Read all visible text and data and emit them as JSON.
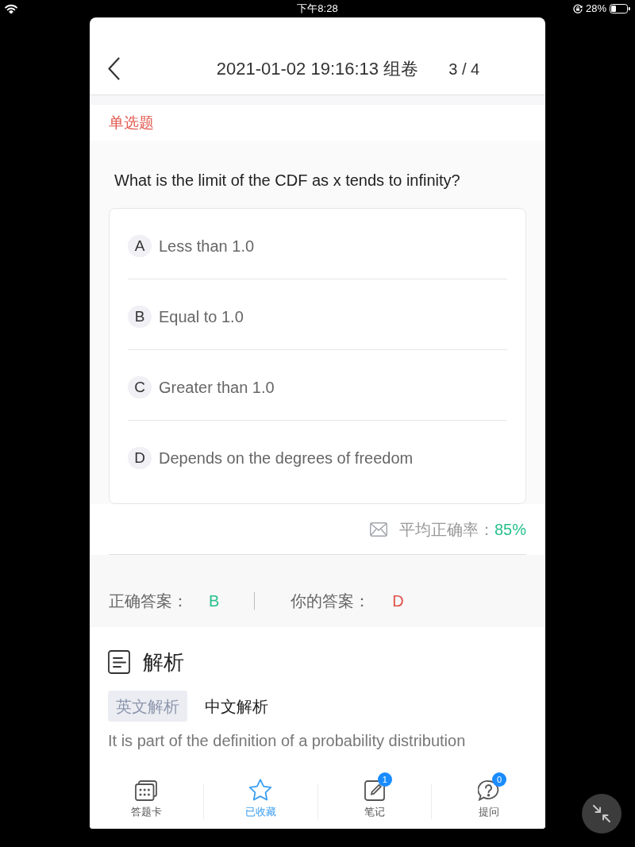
{
  "status_bar": {
    "time": "下午8:28",
    "battery": "28%"
  },
  "header": {
    "title": "2021-01-02 19:16:13 组卷",
    "progress": "3 / 4"
  },
  "question": {
    "type_label": "单选题",
    "text": "What is the limit of the CDF as x tends to infinity?",
    "options": [
      {
        "letter": "A",
        "text": "Less than 1.0"
      },
      {
        "letter": "B",
        "text": "Equal to 1.0"
      },
      {
        "letter": "C",
        "text": "Greater than 1.0"
      },
      {
        "letter": "D",
        "text": "Depends on the degrees of freedom"
      }
    ]
  },
  "stats": {
    "label": "平均正确率：",
    "value": "85%"
  },
  "answers": {
    "correct_label": "正确答案：",
    "correct": "B",
    "yours_label": "你的答案：",
    "yours": "D"
  },
  "analysis": {
    "title": "解析",
    "tabs": [
      {
        "label": "英文解析",
        "selected": true
      },
      {
        "label": "中文解析",
        "selected": false
      }
    ],
    "text": "It is part of the definition of a probability distribution"
  },
  "bottom_nav": [
    {
      "label": "答题卡",
      "selected": false
    },
    {
      "label": "已收藏",
      "selected": true
    },
    {
      "label": "笔记",
      "selected": false,
      "badge": "1"
    },
    {
      "label": "提问",
      "selected": false,
      "badge": "0"
    }
  ]
}
